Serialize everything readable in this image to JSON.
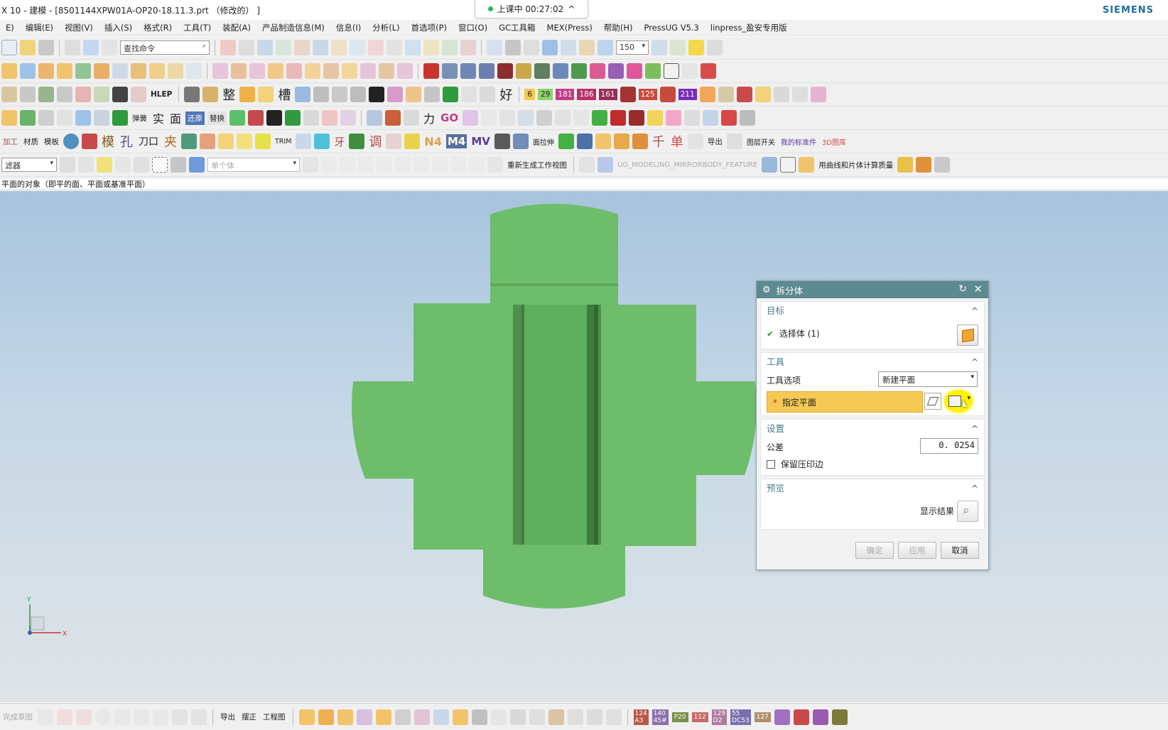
{
  "titlebar": {
    "title": "X 10 - 建模 - [8501144XPW01A-OP20-18.11.3.prt （修改的） ]",
    "brand": "SIEMENS"
  },
  "recording": {
    "status_text": "上课中 00:27:02"
  },
  "menu": [
    "E)",
    "编辑(E)",
    "视图(V)",
    "插入(S)",
    "格式(R)",
    "工具(T)",
    "装配(A)",
    "产品制造信息(M)",
    "信息(I)",
    "分析(L)",
    "首选项(P)",
    "窗口(O)",
    "GC工具箱",
    "MEX(Press)",
    "帮助(H)",
    "PressUG V5.3",
    "linpress_盈安专用版"
  ],
  "toolbar": {
    "find_command_placeholder": "查找命令",
    "zoom_value": "150",
    "filter_value": "滤器",
    "selection_scope": "单个体",
    "regen_view_label": "重新生成工作视图",
    "mirror_feature_label": "UG_MODELING_MIRRORBODY_FEATURE",
    "mass_label": "用曲线和片体计算质量",
    "row3_labels": [
      "HLEP",
      "整",
      "槽",
      "好"
    ],
    "row3_numbers": [
      "6",
      "29",
      "181",
      "186",
      "161",
      "125",
      "211"
    ],
    "row4_labels": [
      "弹簧",
      "实",
      "面",
      "还原",
      "替换",
      "力",
      "GO"
    ],
    "row5_labels": [
      "加工",
      "材质",
      "模板",
      "模",
      "孔",
      "刀口",
      "夹",
      "TRIM",
      "牙",
      "调",
      "N4",
      "M4",
      "MV",
      "面拉伸",
      "千",
      "单",
      "导出",
      "图层开关",
      "我的标准件",
      "3D图库"
    ]
  },
  "cue_line": "平面的对象（即平的面、平面或基准平面）",
  "dialog": {
    "title": "拆分体",
    "group_target": "目标",
    "select_body": "选择体 (1)",
    "group_tool": "工具",
    "tool_option_label": "工具选项",
    "tool_option_value": "新建平面",
    "specify_plane": "指定平面",
    "group_settings": "设置",
    "tolerance_label": "公差",
    "tolerance_value": "0. 0254",
    "keep_imprint": "保留压印边",
    "group_preview": "预览",
    "show_result": "显示结果",
    "ok": "确定",
    "apply": "应用",
    "cancel": "取消"
  },
  "triad": {
    "x": "X",
    "y": "Y"
  },
  "bottombar": {
    "finish_sketch": "完成草图",
    "labels": [
      "导出",
      "摆正",
      "工程图"
    ],
    "numbers": [
      "124",
      "140",
      "P20",
      "112",
      "129",
      "55",
      "127"
    ],
    "codes": [
      "A3",
      "45#",
      "D2",
      "DC53"
    ]
  },
  "colors": {
    "part_green": "#6dbd6b",
    "dialog_title": "#5b8a90",
    "highlight_row": "#f6c955",
    "cursor_halo": "#ffee00"
  }
}
